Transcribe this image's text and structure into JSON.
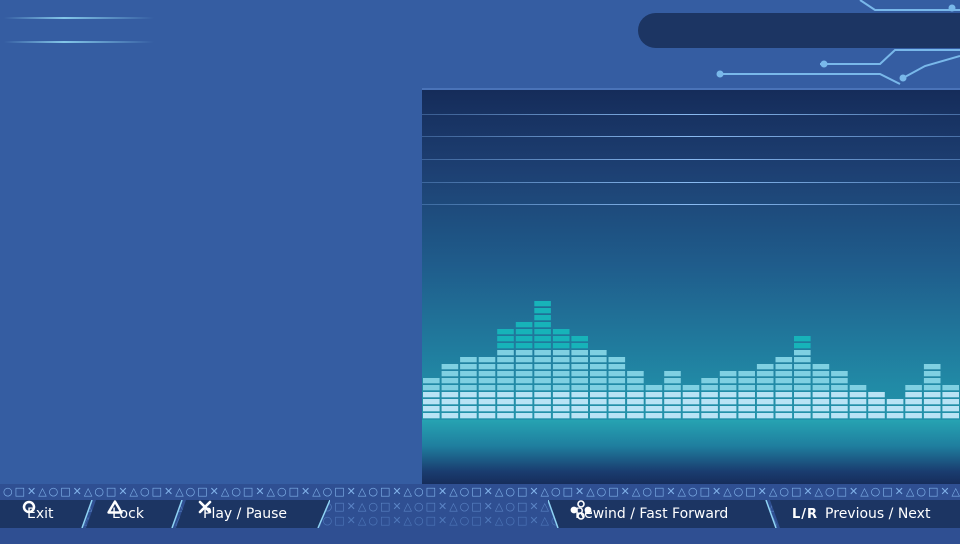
{
  "controls": {
    "exit": {
      "label": "Exit",
      "icon": "circle-button-icon"
    },
    "lock": {
      "label": "Lock",
      "icon": "triangle-button-icon"
    },
    "play_pause": {
      "label": "Play / Pause",
      "icon": "cross-button-icon"
    },
    "seek": {
      "label": "Rewind / Fast Forward",
      "icon": "dpad-icon"
    },
    "track": {
      "key_label": "L/R",
      "label": "Previous / Next"
    }
  },
  "symbol_pattern": "○□✕△○□✕△○□✕△○□✕△○□✕△○□✕△○□✕△○□✕△○□✕△○□✕△○□✕△○□✕△○□✕△○□✕△○□✕△○□✕△○□✕△○□✕△○□✕△○□✕△○□✕△○□✕△○□✕△○□✕△○□✕△○□✕△○□✕△",
  "visualizer": {
    "levels": [
      6,
      8,
      9,
      9,
      13,
      14,
      17,
      13,
      12,
      10,
      9,
      7,
      5,
      7,
      5,
      6,
      7,
      7,
      8,
      9,
      12,
      8,
      7,
      5,
      4,
      3,
      5,
      8,
      5
    ],
    "colors": {
      "low": "#b9e3f5",
      "mid": "#7fd0e2",
      "high": "#17b3b9"
    }
  },
  "colors": {
    "background": "#355da2",
    "title_pill": "#1c3563",
    "button_bar": "#1c3563",
    "accent": "#8fd3f4"
  }
}
